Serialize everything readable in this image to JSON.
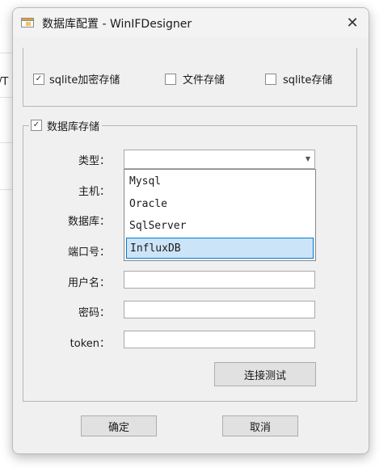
{
  "background": {
    "fragment_text": "/T"
  },
  "window": {
    "title": "数据库配置 - WinIFDesigner",
    "close_glyph": "✕"
  },
  "storage_options": [
    {
      "label": "sqlite加密存储",
      "checked": true
    },
    {
      "label": "文件存储",
      "checked": false
    },
    {
      "label": "sqlite存储",
      "checked": false
    }
  ],
  "database_group": {
    "label": "数据库存储",
    "checked": true,
    "fields": {
      "type_label": "类型：",
      "host_label": "主机：",
      "database_label": "数据库：",
      "port_label": "端口号：",
      "user_label": "用户名：",
      "password_label": "密码：",
      "token_label": "token："
    },
    "type_value": "",
    "type_options": [
      "Mysql",
      "Oracle",
      "SqlServer",
      "InfluxDB"
    ],
    "type_highlighted": "InfluxDB",
    "username_value": "",
    "password_value": "",
    "token_value": "",
    "test_button": "连接测试"
  },
  "footer": {
    "ok_button": "确定",
    "cancel_button": "取消"
  },
  "colors": {
    "highlight": "#cce4f7",
    "highlight_border": "#0078d4",
    "dialog_bg": "#f0f0f0"
  },
  "icons": {
    "app": "app-window-icon",
    "check": "✓",
    "dropdown": "▼"
  }
}
